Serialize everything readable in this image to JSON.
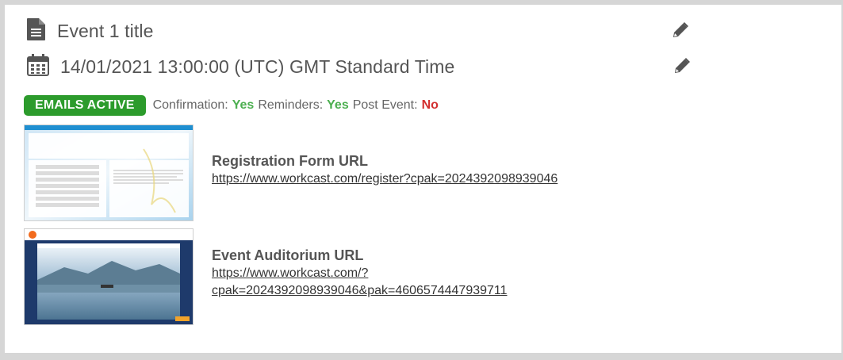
{
  "event": {
    "title": "Event 1 title",
    "datetime": "14/01/2021 13:00:00 (UTC) GMT Standard Time"
  },
  "icons": {
    "title": "document-icon",
    "date": "calendar-icon",
    "edit": "pencil-icon"
  },
  "emails": {
    "badge": "EMAILS ACTIVE",
    "confirmation_label": "Confirmation:",
    "confirmation_value": "Yes",
    "reminders_label": "Reminders:",
    "reminders_value": "Yes",
    "post_event_label": "Post Event:",
    "post_event_value": "No"
  },
  "links": {
    "registration": {
      "label": "Registration Form URL",
      "url": "https://www.workcast.com/register?cpak=2024392098939046"
    },
    "auditorium": {
      "label": "Event Auditorium URL",
      "url_line1": "https://www.workcast.com/?",
      "url_line2": "cpak=2024392098939046&pak=4606574447939711"
    }
  },
  "colors": {
    "badge": "#2c9b2c",
    "yes": "#4caf50",
    "no": "#d32f2f",
    "text": "#555555"
  }
}
